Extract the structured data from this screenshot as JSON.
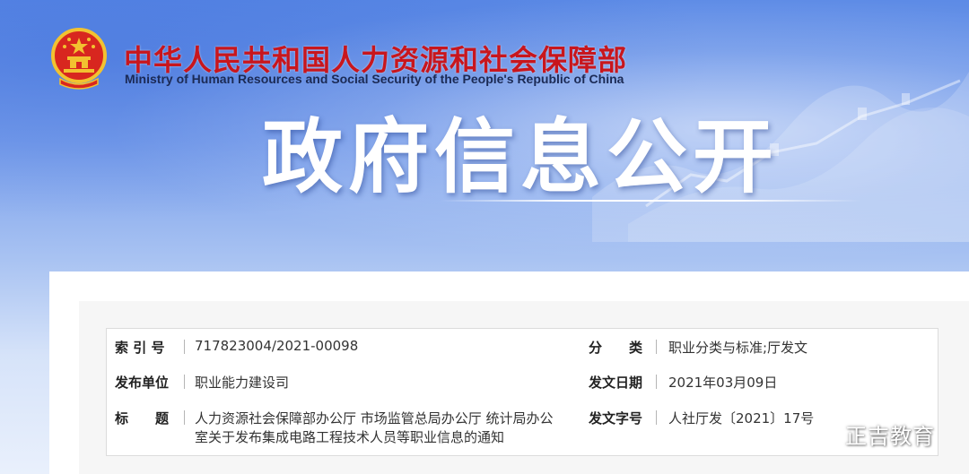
{
  "header": {
    "ministry_cn": "中华人民共和国人力资源和社会保障部",
    "ministry_en": "Ministry of Human Resources and Social Security of the People's Republic of China",
    "page_title": "政府信息公开"
  },
  "info": {
    "index_label": "索 引 号",
    "index_value": "717823004/2021-00098",
    "category_label": "分　　类",
    "category_value": "职业分类与标准;厅发文",
    "issuer_label": "发布单位",
    "issuer_value": "职业能力建设司",
    "date_label": "发文日期",
    "date_value": "2021年03月09日",
    "title_label": "标　　题",
    "title_line1": "人力资源社会保障部办公厅 市场监管总局办公厅 统计局办公",
    "title_line2": "室关于发布集成电路工程技术人员等职业信息的通知",
    "docno_label": "发文字号",
    "docno_value": "人社厅发〔2021〕17号"
  },
  "watermark": {
    "text": "正吉教育",
    "icon": "wechat-icon"
  },
  "colors": {
    "ministry_red": "#c8161d",
    "banner_blue": "#5d8be6"
  }
}
